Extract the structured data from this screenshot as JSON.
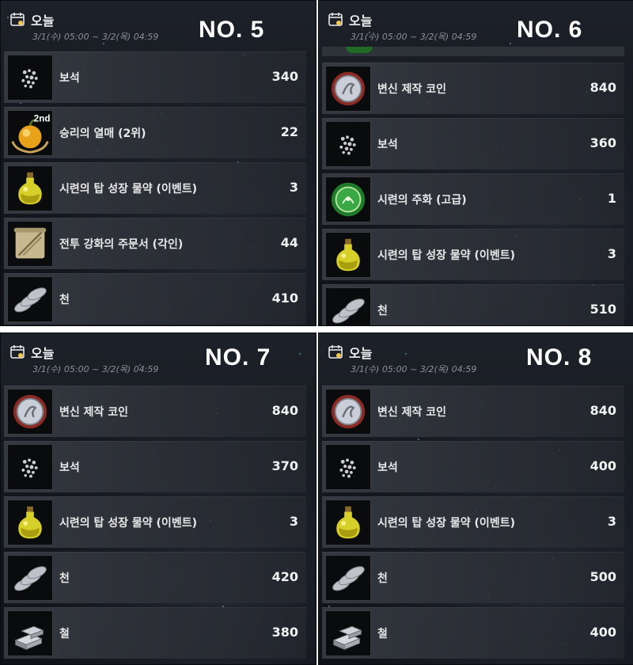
{
  "panels": [
    {
      "no_label": "NO. 5",
      "header": {
        "title": "오늘",
        "date_range": "3/1(수) 05:00 ~ 3/2(목) 04:59"
      },
      "items": [
        {
          "name": "보석",
          "qty": "340",
          "icon": "gems-icon"
        },
        {
          "name": "승리의 열매 (2위)",
          "qty": "22",
          "icon": "victory-fruit-icon",
          "badge": "2nd"
        },
        {
          "name": "시련의 탑 성장 물약 (이벤트)",
          "qty": "3",
          "icon": "potion-icon"
        },
        {
          "name": "전투 강화의 주문서 (각인)",
          "qty": "44",
          "icon": "scroll-icon"
        },
        {
          "name": "천",
          "qty": "410",
          "icon": "cloth-icon"
        }
      ]
    },
    {
      "no_label": "NO. 6",
      "header": {
        "title": "오늘",
        "date_range": "3/1(수) 05:00 ~ 3/2(목) 04:59"
      },
      "items": [
        {
          "name": "변신 제작 코인",
          "qty": "840",
          "icon": "transform-coin-icon"
        },
        {
          "name": "보석",
          "qty": "360",
          "icon": "gems-icon"
        },
        {
          "name": "시련의 주화 (고급)",
          "qty": "1",
          "icon": "trial-coin-icon"
        },
        {
          "name": "시련의 탑 성장 물약 (이벤트)",
          "qty": "3",
          "icon": "potion-icon"
        },
        {
          "name": "천",
          "qty": "510",
          "icon": "cloth-icon"
        }
      ]
    },
    {
      "no_label": "NO. 7",
      "header": {
        "title": "오늘",
        "date_range": "3/1(수) 05:00 ~ 3/2(목) 04:59"
      },
      "items": [
        {
          "name": "변신 제작 코인",
          "qty": "840",
          "icon": "transform-coin-icon"
        },
        {
          "name": "보석",
          "qty": "370",
          "icon": "gems-icon"
        },
        {
          "name": "시련의 탑 성장 물약 (이벤트)",
          "qty": "3",
          "icon": "potion-icon"
        },
        {
          "name": "천",
          "qty": "420",
          "icon": "cloth-icon"
        },
        {
          "name": "철",
          "qty": "380",
          "icon": "iron-icon"
        }
      ]
    },
    {
      "no_label": "NO. 8",
      "header": {
        "title": "오늘",
        "date_range": "3/1(수) 05:00 ~ 3/2(목) 04:59"
      },
      "items": [
        {
          "name": "변신 제작 코인",
          "qty": "840",
          "icon": "transform-coin-icon"
        },
        {
          "name": "보석",
          "qty": "400",
          "icon": "gems-icon"
        },
        {
          "name": "시련의 탑 성장 물약 (이벤트)",
          "qty": "3",
          "icon": "potion-icon"
        },
        {
          "name": "천",
          "qty": "500",
          "icon": "cloth-icon"
        },
        {
          "name": "철",
          "qty": "400",
          "icon": "iron-icon"
        }
      ]
    }
  ],
  "colors": {
    "panel_bg": "#15181e",
    "row_bg": "#3a3e46",
    "text": "#e8e8e8",
    "date_text": "#8c8f96"
  }
}
